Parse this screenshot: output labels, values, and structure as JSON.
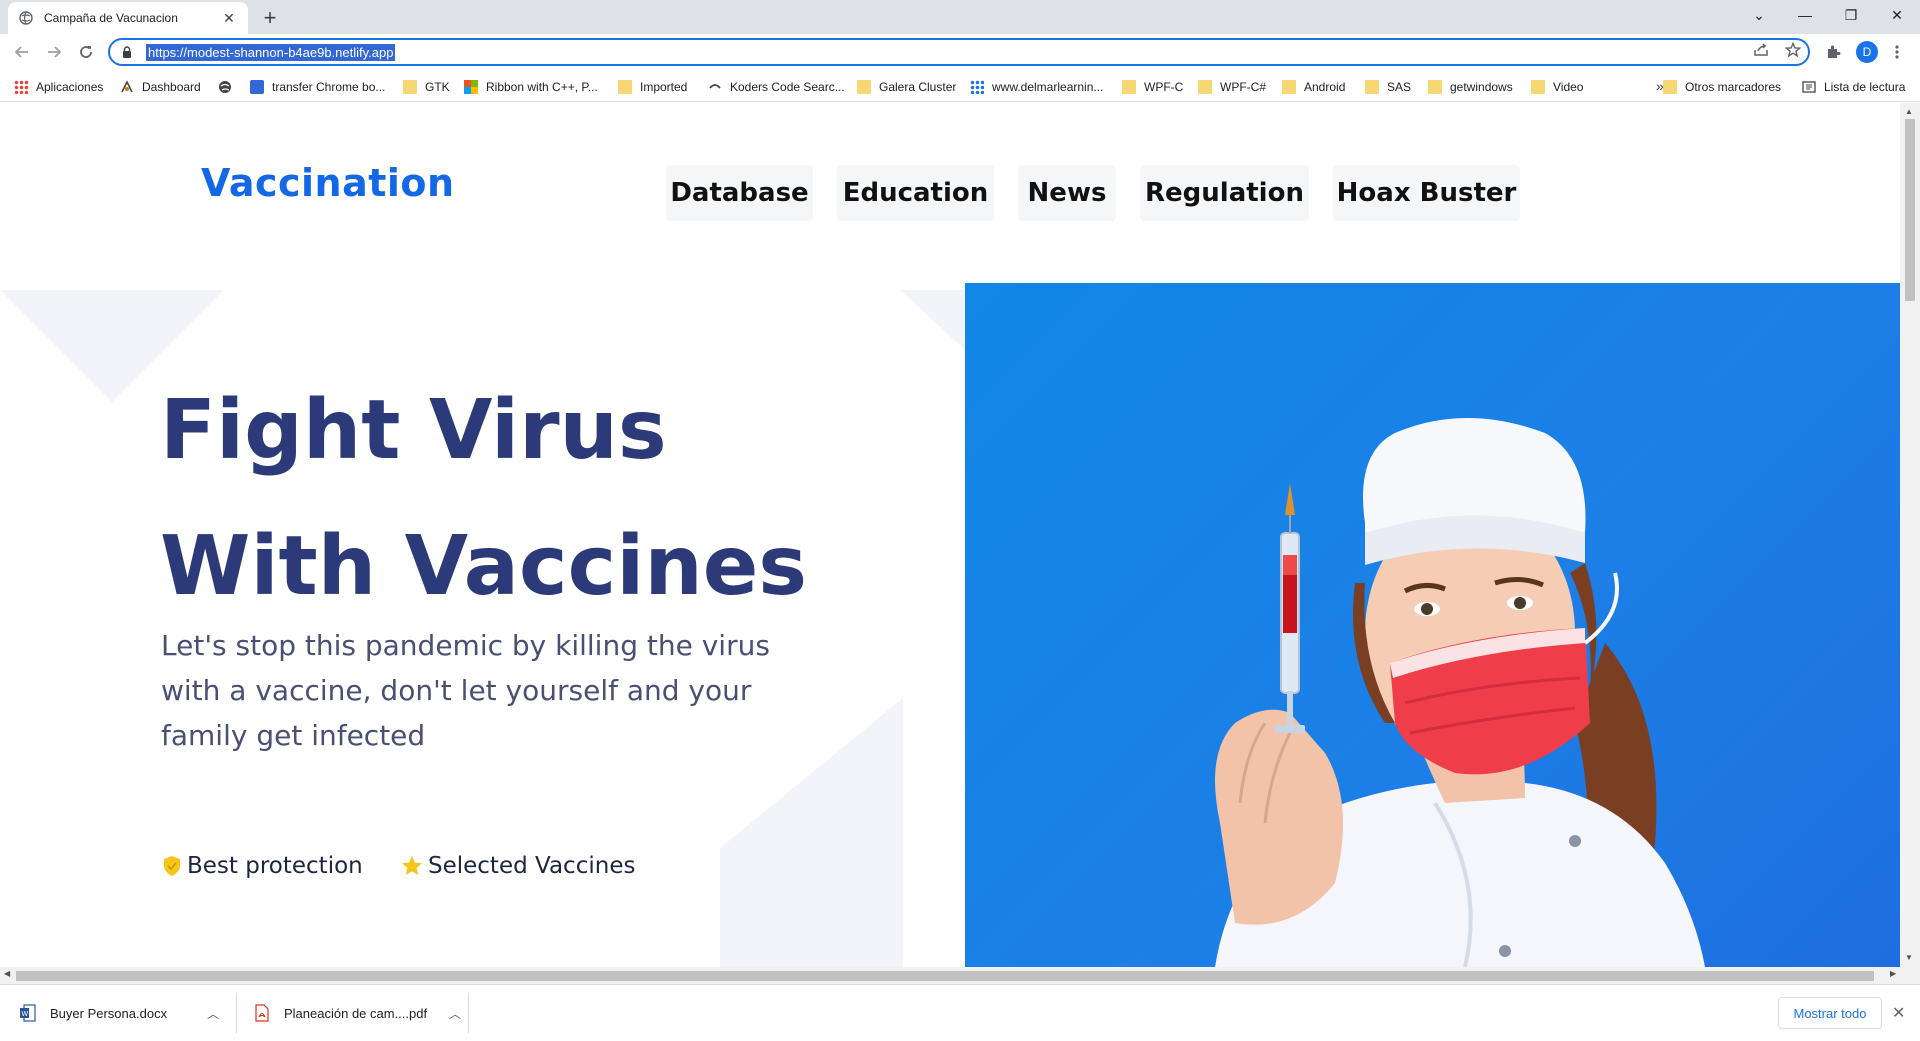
{
  "browser": {
    "tab_title": "Campaña de Vacunacion",
    "tab_close": "✕",
    "new_tab": "+",
    "url": "https://modest-shannon-b4ae9b.netlify.app",
    "avatar_letter": "D",
    "window_controls": [
      "⌄",
      "—",
      "❐",
      "✕"
    ]
  },
  "bookmarks": {
    "items": [
      {
        "label": "Aplicaciones",
        "icon": "apps-grid-icon"
      },
      {
        "label": "Dashboard",
        "icon": "dashboard-icon"
      },
      {
        "label": "",
        "icon": "globe-icon"
      },
      {
        "label": "transfer Chrome bo...",
        "icon": "transfer-icon"
      },
      {
        "label": "GTK",
        "icon": "folder-icon"
      },
      {
        "label": "Ribbon with C++, P...",
        "icon": "windows-icon"
      },
      {
        "label": "Imported",
        "icon": "folder-icon"
      },
      {
        "label": "Koders Code Searc...",
        "icon": "koders-icon"
      },
      {
        "label": "Galera Cluster",
        "icon": "folder-icon"
      },
      {
        "label": "www.delmarlearnin...",
        "icon": "delmar-icon"
      },
      {
        "label": "WPF-C",
        "icon": "folder-icon"
      },
      {
        "label": "WPF-C#",
        "icon": "folder-icon"
      },
      {
        "label": "Android",
        "icon": "folder-icon"
      },
      {
        "label": "SAS",
        "icon": "folder-icon"
      },
      {
        "label": "getwindows",
        "icon": "folder-icon"
      },
      {
        "label": "Video",
        "icon": "folder-icon"
      }
    ],
    "overflow": "»",
    "other": "Otros marcadores",
    "reading_list": "Lista de lectura"
  },
  "site": {
    "logo": "Vaccination",
    "nav": [
      "Database",
      "Education",
      "News",
      "Regulation",
      "Hoax Buster"
    ],
    "hero_title_line1": "Fight Virus",
    "hero_title_line2": "With Vaccines",
    "hero_subtitle": "Let's stop this pandemic by killing the virus with a vaccine, don't let yourself and your family get infected",
    "features": [
      {
        "label": "Best protection",
        "icon": "shield-icon",
        "color": "#f5c518"
      },
      {
        "label": "Selected Vaccines",
        "icon": "star-icon",
        "color": "#f5c518"
      }
    ],
    "colors": {
      "logo": "#1468e6",
      "heading": "#2d3a7a",
      "hero_bg": "#1187e6"
    }
  },
  "downloads": {
    "items": [
      {
        "name": "Buyer Persona.docx",
        "icon": "word-doc-icon"
      },
      {
        "name": "Planeación de cam....pdf",
        "icon": "pdf-icon"
      }
    ],
    "show_all": "Mostrar todo",
    "close": "✕"
  }
}
